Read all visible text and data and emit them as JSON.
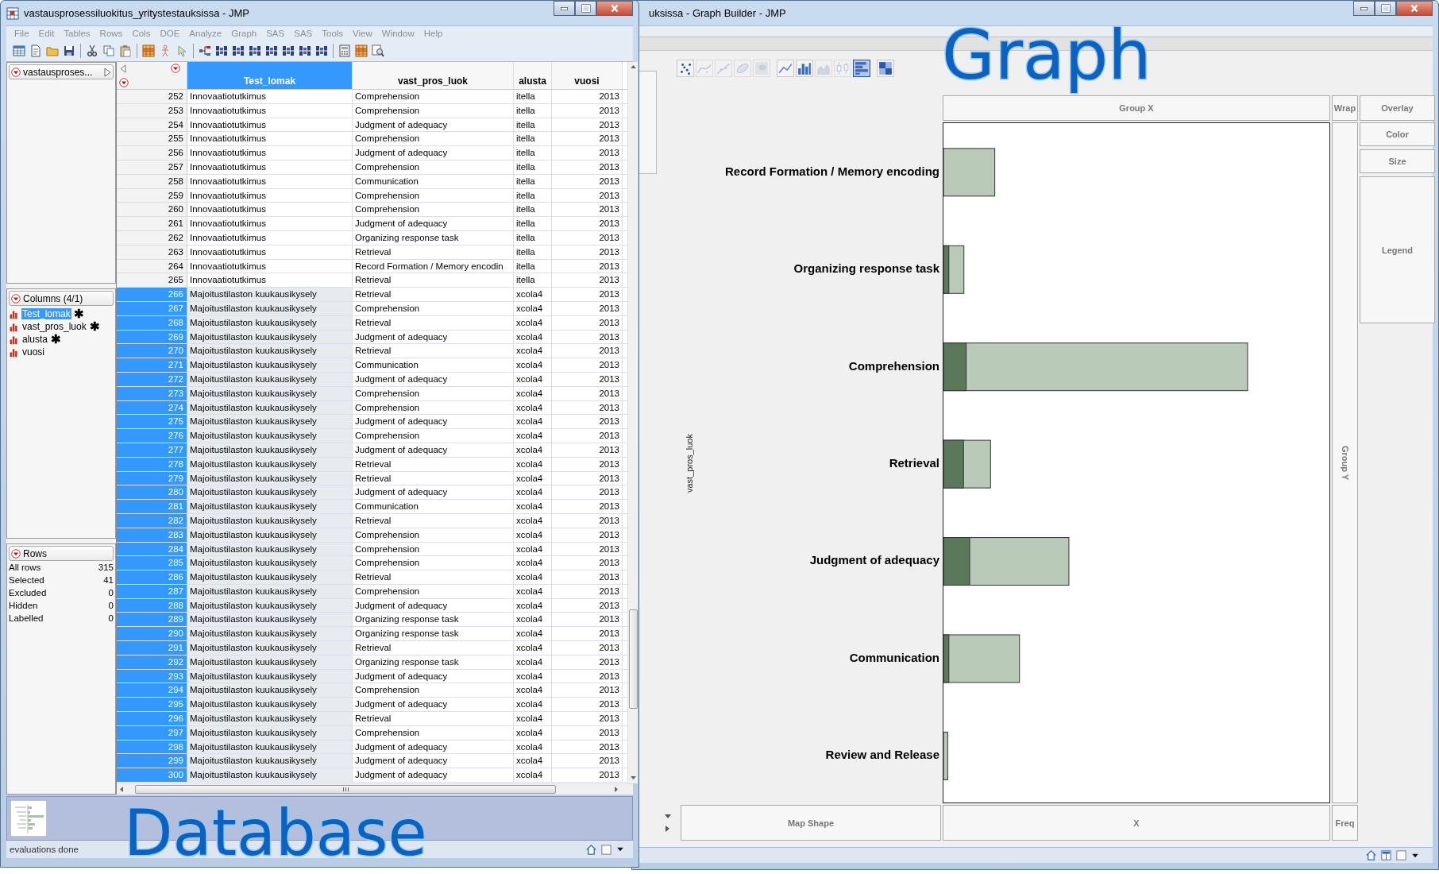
{
  "data_window": {
    "title": "vastausprosessiluokitus_yritystestauksissa - JMP",
    "menu": [
      "File",
      "Edit",
      "Tables",
      "Rows",
      "Cols",
      "DOE",
      "Analyze",
      "Graph",
      "SAS",
      "SAS",
      "Tools",
      "View",
      "Window",
      "Help"
    ],
    "table_panel": {
      "title": "vastausproses..."
    },
    "columns_panel": {
      "title": "Columns (4/1)",
      "columns": [
        {
          "name": "Test_lomak",
          "selected": true,
          "mark": "✱"
        },
        {
          "name": "vast_pros_luok",
          "selected": false,
          "mark": "✱"
        },
        {
          "name": "alusta",
          "selected": false,
          "mark": "✱"
        },
        {
          "name": "vuosi",
          "selected": false
        }
      ]
    },
    "rows_panel": {
      "title": "Rows",
      "stats": [
        {
          "label": "All rows",
          "value": "315"
        },
        {
          "label": "Selected",
          "value": "41"
        },
        {
          "label": "Excluded",
          "value": "0"
        },
        {
          "label": "Hidden",
          "value": "0"
        },
        {
          "label": "Labelled",
          "value": "0"
        }
      ]
    },
    "table": {
      "columns": [
        {
          "name": "Test_lomak",
          "selected": true
        },
        {
          "name": "vast_pros_luok",
          "selected": false
        },
        {
          "name": "alusta",
          "selected": false
        },
        {
          "name": "vuosi",
          "selected": false
        }
      ],
      "rows": [
        {
          "n": "252",
          "cells": [
            "Innovaatiotutkimus",
            "Comprehension",
            "itella",
            "2013"
          ],
          "selected": false
        },
        {
          "n": "253",
          "cells": [
            "Innovaatiotutkimus",
            "Comprehension",
            "itella",
            "2013"
          ],
          "selected": false
        },
        {
          "n": "254",
          "cells": [
            "Innovaatiotutkimus",
            "Judgment of adequacy",
            "itella",
            "2013"
          ],
          "selected": false
        },
        {
          "n": "255",
          "cells": [
            "Innovaatiotutkimus",
            "Comprehension",
            "itella",
            "2013"
          ],
          "selected": false
        },
        {
          "n": "256",
          "cells": [
            "Innovaatiotutkimus",
            "Judgment of adequacy",
            "itella",
            "2013"
          ],
          "selected": false
        },
        {
          "n": "257",
          "cells": [
            "Innovaatiotutkimus",
            "Comprehension",
            "itella",
            "2013"
          ],
          "selected": false
        },
        {
          "n": "258",
          "cells": [
            "Innovaatiotutkimus",
            "Communication",
            "itella",
            "2013"
          ],
          "selected": false
        },
        {
          "n": "259",
          "cells": [
            "Innovaatiotutkimus",
            "Comprehension",
            "itella",
            "2013"
          ],
          "selected": false
        },
        {
          "n": "260",
          "cells": [
            "Innovaatiotutkimus",
            "Comprehension",
            "itella",
            "2013"
          ],
          "selected": false
        },
        {
          "n": "261",
          "cells": [
            "Innovaatiotutkimus",
            "Judgment of adequacy",
            "itella",
            "2013"
          ],
          "selected": false
        },
        {
          "n": "262",
          "cells": [
            "Innovaatiotutkimus",
            "Organizing response task",
            "itella",
            "2013"
          ],
          "selected": false
        },
        {
          "n": "263",
          "cells": [
            "Innovaatiotutkimus",
            "Retrieval",
            "itella",
            "2013"
          ],
          "selected": false
        },
        {
          "n": "264",
          "cells": [
            "Innovaatiotutkimus",
            "Record Formation / Memory encodin",
            "itella",
            "2013"
          ],
          "selected": false
        },
        {
          "n": "265",
          "cells": [
            "Innovaatiotutkimus",
            "Retrieval",
            "itella",
            "2013"
          ],
          "selected": false
        },
        {
          "n": "266",
          "cells": [
            "Majoitustilaston kuukausikysely",
            "Retrieval",
            "xcola4",
            "2013"
          ],
          "selected": true
        },
        {
          "n": "267",
          "cells": [
            "Majoitustilaston kuukausikysely",
            "Comprehension",
            "xcola4",
            "2013"
          ],
          "selected": true
        },
        {
          "n": "268",
          "cells": [
            "Majoitustilaston kuukausikysely",
            "Retrieval",
            "xcola4",
            "2013"
          ],
          "selected": true
        },
        {
          "n": "269",
          "cells": [
            "Majoitustilaston kuukausikysely",
            "Judgment of adequacy",
            "xcola4",
            "2013"
          ],
          "selected": true
        },
        {
          "n": "270",
          "cells": [
            "Majoitustilaston kuukausikysely",
            "Retrieval",
            "xcola4",
            "2013"
          ],
          "selected": true
        },
        {
          "n": "271",
          "cells": [
            "Majoitustilaston kuukausikysely",
            "Communication",
            "xcola4",
            "2013"
          ],
          "selected": true
        },
        {
          "n": "272",
          "cells": [
            "Majoitustilaston kuukausikysely",
            "Judgment of adequacy",
            "xcola4",
            "2013"
          ],
          "selected": true
        },
        {
          "n": "273",
          "cells": [
            "Majoitustilaston kuukausikysely",
            "Comprehension",
            "xcola4",
            "2013"
          ],
          "selected": true
        },
        {
          "n": "274",
          "cells": [
            "Majoitustilaston kuukausikysely",
            "Comprehension",
            "xcola4",
            "2013"
          ],
          "selected": true
        },
        {
          "n": "275",
          "cells": [
            "Majoitustilaston kuukausikysely",
            "Judgment of adequacy",
            "xcola4",
            "2013"
          ],
          "selected": true
        },
        {
          "n": "276",
          "cells": [
            "Majoitustilaston kuukausikysely",
            "Comprehension",
            "xcola4",
            "2013"
          ],
          "selected": true
        },
        {
          "n": "277",
          "cells": [
            "Majoitustilaston kuukausikysely",
            "Judgment of adequacy",
            "xcola4",
            "2013"
          ],
          "selected": true
        },
        {
          "n": "278",
          "cells": [
            "Majoitustilaston kuukausikysely",
            "Retrieval",
            "xcola4",
            "2013"
          ],
          "selected": true
        },
        {
          "n": "279",
          "cells": [
            "Majoitustilaston kuukausikysely",
            "Retrieval",
            "xcola4",
            "2013"
          ],
          "selected": true
        },
        {
          "n": "280",
          "cells": [
            "Majoitustilaston kuukausikysely",
            "Judgment of adequacy",
            "xcola4",
            "2013"
          ],
          "selected": true
        },
        {
          "n": "281",
          "cells": [
            "Majoitustilaston kuukausikysely",
            "Communication",
            "xcola4",
            "2013"
          ],
          "selected": true
        },
        {
          "n": "282",
          "cells": [
            "Majoitustilaston kuukausikysely",
            "Retrieval",
            "xcola4",
            "2013"
          ],
          "selected": true
        },
        {
          "n": "283",
          "cells": [
            "Majoitustilaston kuukausikysely",
            "Comprehension",
            "xcola4",
            "2013"
          ],
          "selected": true
        },
        {
          "n": "284",
          "cells": [
            "Majoitustilaston kuukausikysely",
            "Comprehension",
            "xcola4",
            "2013"
          ],
          "selected": true
        },
        {
          "n": "285",
          "cells": [
            "Majoitustilaston kuukausikysely",
            "Comprehension",
            "xcola4",
            "2013"
          ],
          "selected": true
        },
        {
          "n": "286",
          "cells": [
            "Majoitustilaston kuukausikysely",
            "Retrieval",
            "xcola4",
            "2013"
          ],
          "selected": true
        },
        {
          "n": "287",
          "cells": [
            "Majoitustilaston kuukausikysely",
            "Comprehension",
            "xcola4",
            "2013"
          ],
          "selected": true
        },
        {
          "n": "288",
          "cells": [
            "Majoitustilaston kuukausikysely",
            "Judgment of adequacy",
            "xcola4",
            "2013"
          ],
          "selected": true
        },
        {
          "n": "289",
          "cells": [
            "Majoitustilaston kuukausikysely",
            "Organizing response task",
            "xcola4",
            "2013"
          ],
          "selected": true
        },
        {
          "n": "290",
          "cells": [
            "Majoitustilaston kuukausikysely",
            "Organizing response task",
            "xcola4",
            "2013"
          ],
          "selected": true
        },
        {
          "n": "291",
          "cells": [
            "Majoitustilaston kuukausikysely",
            "Retrieval",
            "xcola4",
            "2013"
          ],
          "selected": true
        },
        {
          "n": "292",
          "cells": [
            "Majoitustilaston kuukausikysely",
            "Organizing response task",
            "xcola4",
            "2013"
          ],
          "selected": true
        },
        {
          "n": "293",
          "cells": [
            "Majoitustilaston kuukausikysely",
            "Judgment of adequacy",
            "xcola4",
            "2013"
          ],
          "selected": true
        },
        {
          "n": "294",
          "cells": [
            "Majoitustilaston kuukausikysely",
            "Comprehension",
            "xcola4",
            "2013"
          ],
          "selected": true
        },
        {
          "n": "295",
          "cells": [
            "Majoitustilaston kuukausikysely",
            "Judgment of adequacy",
            "xcola4",
            "2013"
          ],
          "selected": true
        },
        {
          "n": "296",
          "cells": [
            "Majoitustilaston kuukausikysely",
            "Retrieval",
            "xcola4",
            "2013"
          ],
          "selected": true
        },
        {
          "n": "297",
          "cells": [
            "Majoitustilaston kuukausikysely",
            "Comprehension",
            "xcola4",
            "2013"
          ],
          "selected": true
        },
        {
          "n": "298",
          "cells": [
            "Majoitustilaston kuukausikysely",
            "Judgment of adequacy",
            "xcola4",
            "2013"
          ],
          "selected": true
        },
        {
          "n": "299",
          "cells": [
            "Majoitustilaston kuukausikysely",
            "Judgment of adequacy",
            "xcola4",
            "2013"
          ],
          "selected": true
        },
        {
          "n": "300",
          "cells": [
            "Majoitustilaston kuukausikysely",
            "Judgment of adequacy",
            "xcola4",
            "2013"
          ],
          "selected": true
        }
      ]
    },
    "status": "evaluations done"
  },
  "graph_window": {
    "title": "uksissa - Graph Builder - JMP",
    "elements": [
      {
        "kind": "points",
        "selected": false,
        "disabled": false
      },
      {
        "kind": "smoother",
        "selected": false,
        "disabled": true
      },
      {
        "kind": "line_of_fit",
        "selected": false,
        "disabled": true
      },
      {
        "kind": "ellipse",
        "selected": false,
        "disabled": true
      },
      {
        "kind": "contour",
        "selected": false,
        "disabled": true
      },
      {
        "kind": "line",
        "selected": false,
        "disabled": false
      },
      {
        "kind": "bar",
        "selected": false,
        "disabled": false
      },
      {
        "kind": "area",
        "selected": false,
        "disabled": true
      },
      {
        "kind": "box_plot",
        "selected": false,
        "disabled": true
      },
      {
        "kind": "histogram",
        "selected": true,
        "disabled": false
      },
      {
        "kind": "heatmap",
        "selected": false,
        "disabled": false
      }
    ],
    "zones": {
      "group_x": "Group X",
      "wrap": "Wrap",
      "overlay": "Overlay",
      "color_role": "Color",
      "size": "Size",
      "legend": "Legend",
      "group_y": "Group Y",
      "map_shape": "Map Shape",
      "x": "X",
      "freq": "Freq"
    },
    "y_title": "vast_pros_luok",
    "categories": [
      "Record Formation / Memory encoding",
      "Organizing response task",
      "Comprehension",
      "Retrieval",
      "Judgment of adequacy",
      "Communication",
      "Review and Release"
    ]
  },
  "overlay_labels": [
    {
      "text": "Graph",
      "kind": "graph"
    },
    {
      "text": "Database",
      "kind": "database"
    }
  ]
}
